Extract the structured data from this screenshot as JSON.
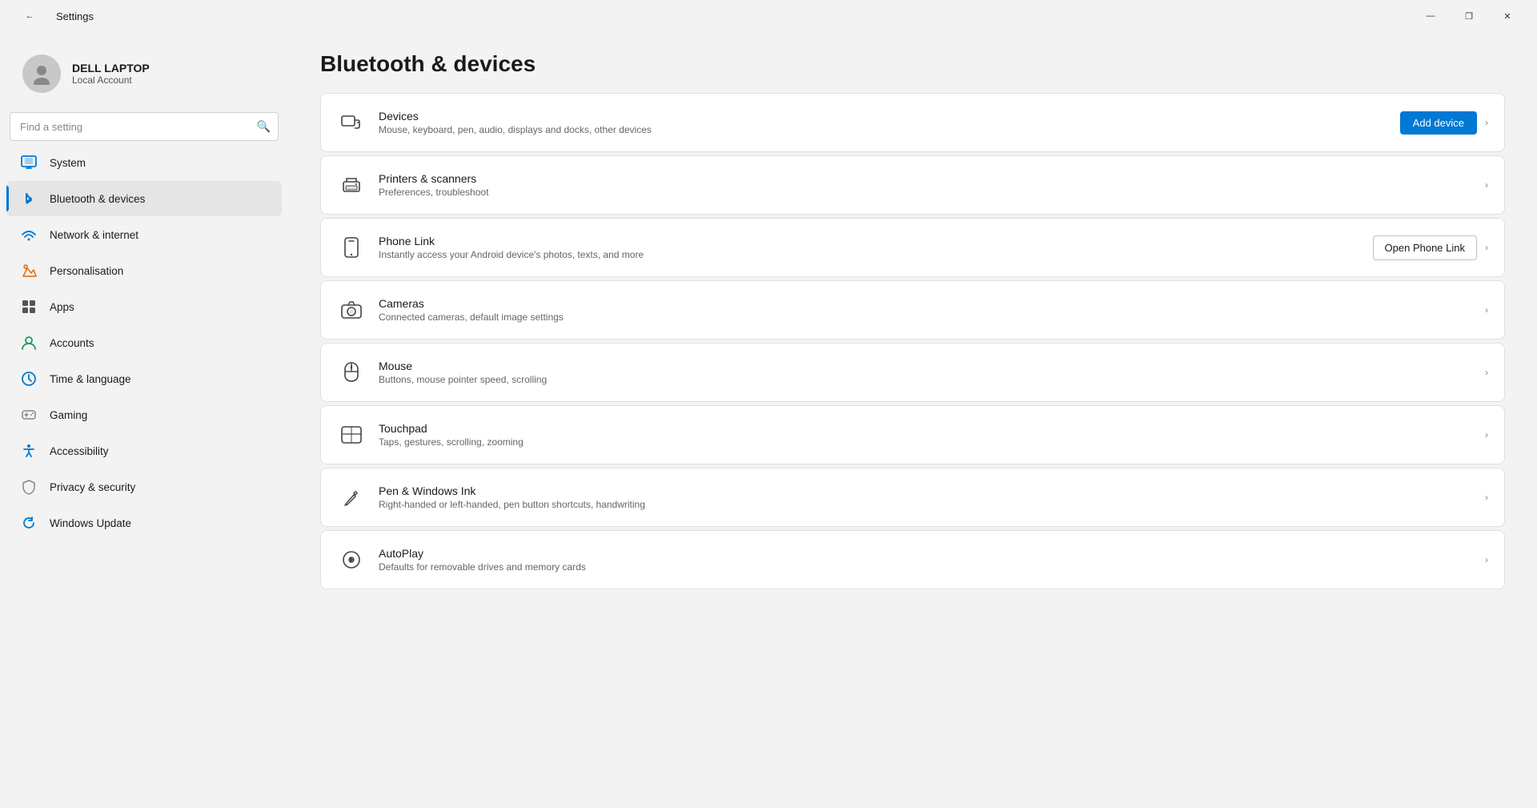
{
  "titlebar": {
    "title": "Settings",
    "back_label": "←",
    "minimize": "—",
    "maximize": "❐",
    "close": "✕"
  },
  "user": {
    "name": "DELL LAPTOP",
    "account_type": "Local Account"
  },
  "search": {
    "placeholder": "Find a setting"
  },
  "nav": {
    "items": [
      {
        "id": "system",
        "label": "System",
        "active": false
      },
      {
        "id": "bluetooth",
        "label": "Bluetooth & devices",
        "active": true
      },
      {
        "id": "network",
        "label": "Network & internet",
        "active": false
      },
      {
        "id": "personalisation",
        "label": "Personalisation",
        "active": false
      },
      {
        "id": "apps",
        "label": "Apps",
        "active": false
      },
      {
        "id": "accounts",
        "label": "Accounts",
        "active": false
      },
      {
        "id": "time",
        "label": "Time & language",
        "active": false
      },
      {
        "id": "gaming",
        "label": "Gaming",
        "active": false
      },
      {
        "id": "accessibility",
        "label": "Accessibility",
        "active": false
      },
      {
        "id": "privacy",
        "label": "Privacy & security",
        "active": false
      },
      {
        "id": "update",
        "label": "Windows Update",
        "active": false
      }
    ]
  },
  "main": {
    "page_title": "Bluetooth & devices",
    "settings": [
      {
        "id": "devices",
        "title": "Devices",
        "desc": "Mouse, keyboard, pen, audio, displays and docks, other devices",
        "action": "add_device",
        "action_label": "Add device"
      },
      {
        "id": "printers",
        "title": "Printers & scanners",
        "desc": "Preferences, troubleshoot",
        "action": "chevron"
      },
      {
        "id": "phone-link",
        "title": "Phone Link",
        "desc": "Instantly access your Android device's photos, texts, and more",
        "action": "open_phone",
        "action_label": "Open Phone Link"
      },
      {
        "id": "cameras",
        "title": "Cameras",
        "desc": "Connected cameras, default image settings",
        "action": "chevron"
      },
      {
        "id": "mouse",
        "title": "Mouse",
        "desc": "Buttons, mouse pointer speed, scrolling",
        "action": "chevron"
      },
      {
        "id": "touchpad",
        "title": "Touchpad",
        "desc": "Taps, gestures, scrolling, zooming",
        "action": "chevron"
      },
      {
        "id": "pen",
        "title": "Pen & Windows Ink",
        "desc": "Right-handed or left-handed, pen button shortcuts, handwriting",
        "action": "chevron"
      },
      {
        "id": "autoplay",
        "title": "AutoPlay",
        "desc": "Defaults for removable drives and memory cards",
        "action": "chevron"
      }
    ]
  }
}
